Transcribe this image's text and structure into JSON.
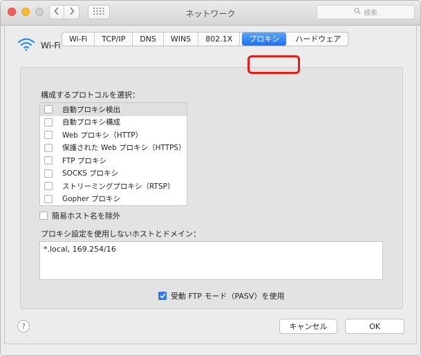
{
  "window": {
    "title": "ネットワーク",
    "search_placeholder": "検索"
  },
  "interface": {
    "name": "Wi-Fi",
    "icon": "wifi-icon"
  },
  "tabs": [
    {
      "label": "Wi-Fi",
      "selected": false
    },
    {
      "label": "TCP/IP",
      "selected": false
    },
    {
      "label": "DNS",
      "selected": false
    },
    {
      "label": "WINS",
      "selected": false
    },
    {
      "label": "802.1X",
      "selected": false
    },
    {
      "label": "プロキシ",
      "selected": true
    },
    {
      "label": "ハードウェア",
      "selected": false
    }
  ],
  "highlight_color": "#e41c1c",
  "accent_color": "#1e6ff3",
  "proxy": {
    "protocols_label": "構成するプロトコルを選択：",
    "protocols": [
      {
        "label": "自動プロキシ検出",
        "checked": false
      },
      {
        "label": "自動プロキシ構成",
        "checked": false
      },
      {
        "label": "Web プロキシ（HTTP）",
        "checked": false
      },
      {
        "label": "保護された Web プロキシ（HTTPS）",
        "checked": false
      },
      {
        "label": "FTP プロキシ",
        "checked": false
      },
      {
        "label": "SOCKS プロキシ",
        "checked": false
      },
      {
        "label": "ストリーミングプロキシ（RTSP）",
        "checked": false
      },
      {
        "label": "Gopher プロキシ",
        "checked": false
      }
    ],
    "exclude_simple_hostnames": {
      "label": "簡易ホスト名を除外",
      "checked": false
    },
    "bypass_label": "プロキシ設定を使用しないホストとドメイン：",
    "bypass_value": "*.local, 169.254/16",
    "passive_ftp": {
      "label": "受動 FTP モード（PASV）を使用",
      "checked": true
    }
  },
  "footer": {
    "help_label": "?",
    "cancel_label": "キャンセル",
    "ok_label": "OK"
  }
}
